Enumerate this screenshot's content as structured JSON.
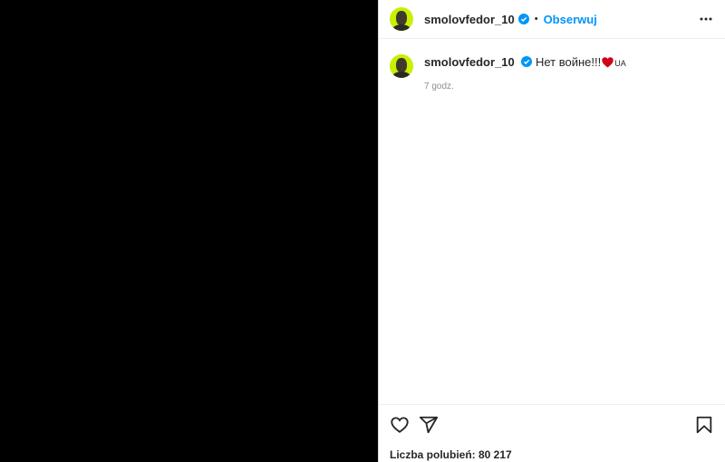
{
  "post": {
    "username": "smolovfedor_10",
    "follow_label": "Obserwuj",
    "separator": "•"
  },
  "caption": {
    "username": "smolovfedor_10",
    "text": "Нет войне!!!",
    "flag_text": "UA",
    "time": "7 godz."
  },
  "footer": {
    "likes": "Liczba polubień: 80 217"
  },
  "colors": {
    "accent": "#0095f6",
    "avatar_bg": "#c8f000",
    "heart": "#d0011b"
  },
  "icons": [
    "verified-badge-icon",
    "more-options-icon",
    "like-heart-icon",
    "share-send-icon",
    "bookmark-icon",
    "red-heart-emoji"
  ]
}
